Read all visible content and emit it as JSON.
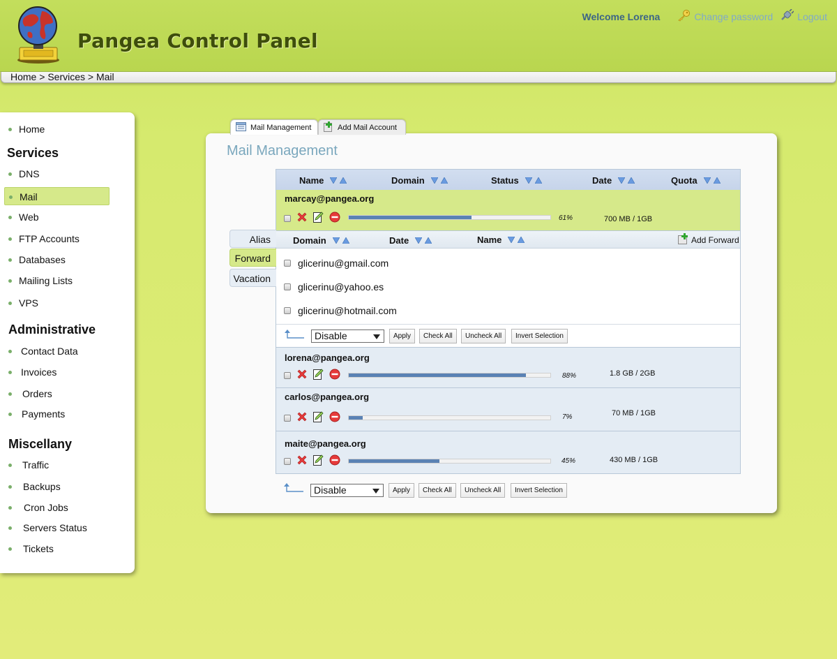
{
  "header": {
    "app_title": "Pangea Control Panel",
    "welcome": "Welcome Lorena",
    "change_password": "Change password",
    "logout": "Logout"
  },
  "breadcrumb": {
    "home": "Home",
    "services": "Services",
    "mail": "Mail",
    "sep": " > "
  },
  "sidebar": {
    "home": "Home",
    "services_heading": "Services",
    "services": [
      "DNS",
      "Mail",
      "Web",
      "FTP Accounts",
      "Databases",
      "Mailing Lists",
      "VPS"
    ],
    "administrative_heading": "Administrative",
    "administrative": [
      "Contact Data",
      "Invoices",
      "Orders",
      "Payments"
    ],
    "miscellany_heading": "Miscellany",
    "miscellany": [
      "Traffic",
      "Backups",
      "Cron Jobs",
      "Servers Status",
      "Tickets"
    ]
  },
  "tabs": {
    "mail_management": "Mail Management",
    "add_mail_account": "Add Mail Account"
  },
  "panel_title": "Mail Management",
  "columns": {
    "name": "Name",
    "domain": "Domain",
    "status": "Status",
    "date": "Date",
    "quota": "Quota"
  },
  "accounts": [
    {
      "email": "marcay@pangea.org",
      "usage": 61,
      "usage_label": "61%",
      "quota": "700 MB / 1GB"
    },
    {
      "email": "lorena@pangea.org",
      "usage": 88,
      "usage_label": "88%",
      "quota": "1.8 GB / 2GB"
    },
    {
      "email": "carlos@pangea.org",
      "usage": 7,
      "usage_label": "7%",
      "quota": "70 MB / 1GB"
    },
    {
      "email": "maite@pangea.org",
      "usage": 45,
      "usage_label": "45%",
      "quota": "430 MB / 1GB"
    }
  ],
  "subpanel": {
    "side_tabs": [
      "Alias",
      "Forward",
      "Vacation"
    ],
    "columns": {
      "domain": "Domain",
      "date": "Date",
      "name": "Name"
    },
    "add_forward": "Add Forward",
    "forwards": [
      "glicerinu@gmail.com",
      "glicerinu@yahoo.es",
      "glicerinu@hotmail.com"
    ]
  },
  "actions": {
    "select_value": "Disable",
    "apply": "Apply",
    "check_all": "Check All",
    "uncheck_all": "Uncheck All",
    "invert_selection": "Invert Selection"
  },
  "colors": {
    "accent": "#7aa7bd",
    "header_bg": "#bcd853",
    "selected_row": "#d6e98a",
    "bar_fill": "#5a82b4"
  }
}
